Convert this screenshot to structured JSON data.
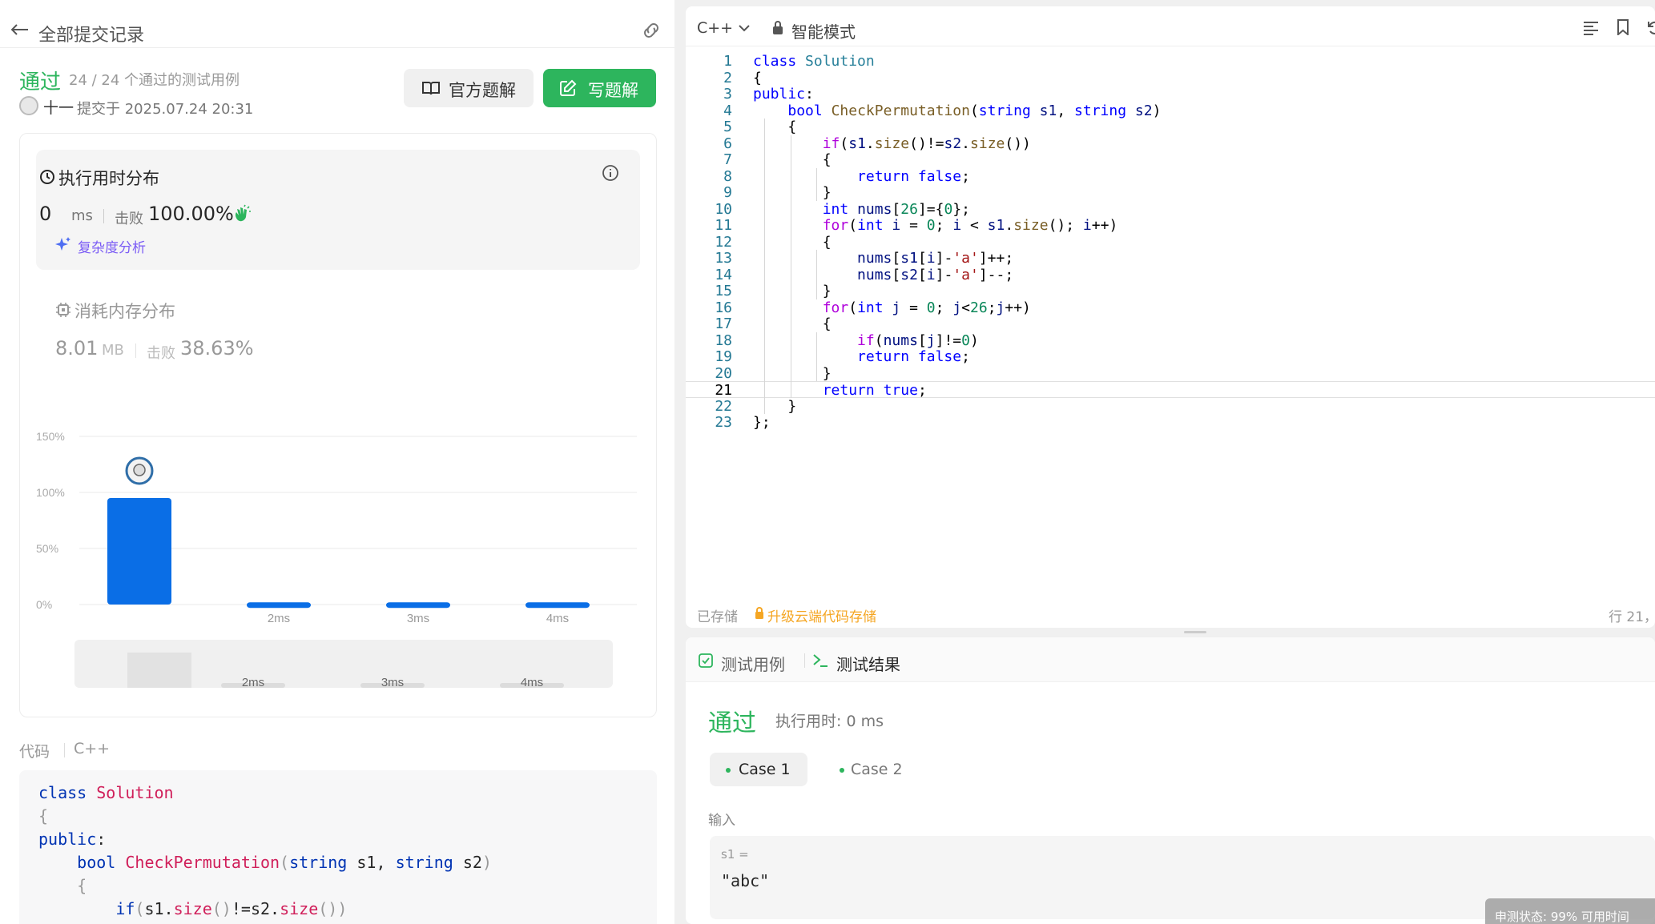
{
  "header": {
    "back_label": "全部提交记录"
  },
  "submission": {
    "status": "通过",
    "cases_text": "24 / 24 个通过的测试用例",
    "user": "十一",
    "submitted_at": "提交于 2025.07.24 20:31",
    "official_label": "官方题解",
    "write_label": "写题解"
  },
  "runtime": {
    "title": "执行用时分布",
    "value": "0",
    "unit": "ms",
    "beat_label": "击败",
    "beat_value": "100.00%",
    "complexity_link": "复杂度分析"
  },
  "memory": {
    "title": "消耗内存分布",
    "value": "8.01",
    "unit": "MB",
    "beat_label": "击败",
    "beat_value": "38.63%"
  },
  "chart_data": {
    "type": "bar",
    "categories": [
      "",
      "2ms",
      "3ms",
      "4ms"
    ],
    "values": [
      95,
      2,
      2,
      2
    ],
    "yticks": [
      "150%",
      "100%",
      "50%",
      "0%"
    ],
    "ylim": [
      0,
      150
    ],
    "mini_labels": [
      "2ms",
      "3ms",
      "4ms"
    ],
    "bar_color": "#0a6ee6"
  },
  "code_section": {
    "label": "代码",
    "lang": "C++",
    "preview": [
      "class Solution",
      "{",
      "public:",
      "    bool CheckPermutation(string s1, string s2)",
      "    {",
      "        if(s1.size()!=s2.size())"
    ]
  },
  "editor": {
    "lang": "C++",
    "mode": "智能模式",
    "saved": "已存储",
    "upgrade": "升级云端代码存储",
    "cursor": "行 21，",
    "active_line": 21,
    "lines": [
      "class Solution",
      "{",
      "public:",
      "    bool CheckPermutation(string s1, string s2)",
      "    {",
      "        if(s1.size()!=s2.size())",
      "        {",
      "            return false;",
      "        }",
      "        int nums[26]={0};",
      "        for(int i = 0; i < s1.size(); i++)",
      "        {",
      "            nums[s1[i]-'a']++;",
      "            nums[s2[i]-'a']--;",
      "        }",
      "        for(int j = 0; j<26;j++)",
      "        {",
      "            if(nums[j]!=0)",
      "            return false;",
      "        }",
      "        return true;",
      "    }",
      "};"
    ]
  },
  "results": {
    "tab_testcase": "测试用例",
    "tab_result": "测试结果",
    "status": "通过",
    "time_text": "执行用时: 0 ms",
    "cases": [
      "Case 1",
      "Case 2"
    ],
    "input_label": "输入",
    "input_var": "s1 =",
    "input_value": "\"abc\""
  },
  "toast": {
    "text": "申测状态: 99% 可用时间"
  },
  "colors": {
    "accent": "#2db55d",
    "bar": "#0a6ee6",
    "warning": "#f5a623"
  }
}
